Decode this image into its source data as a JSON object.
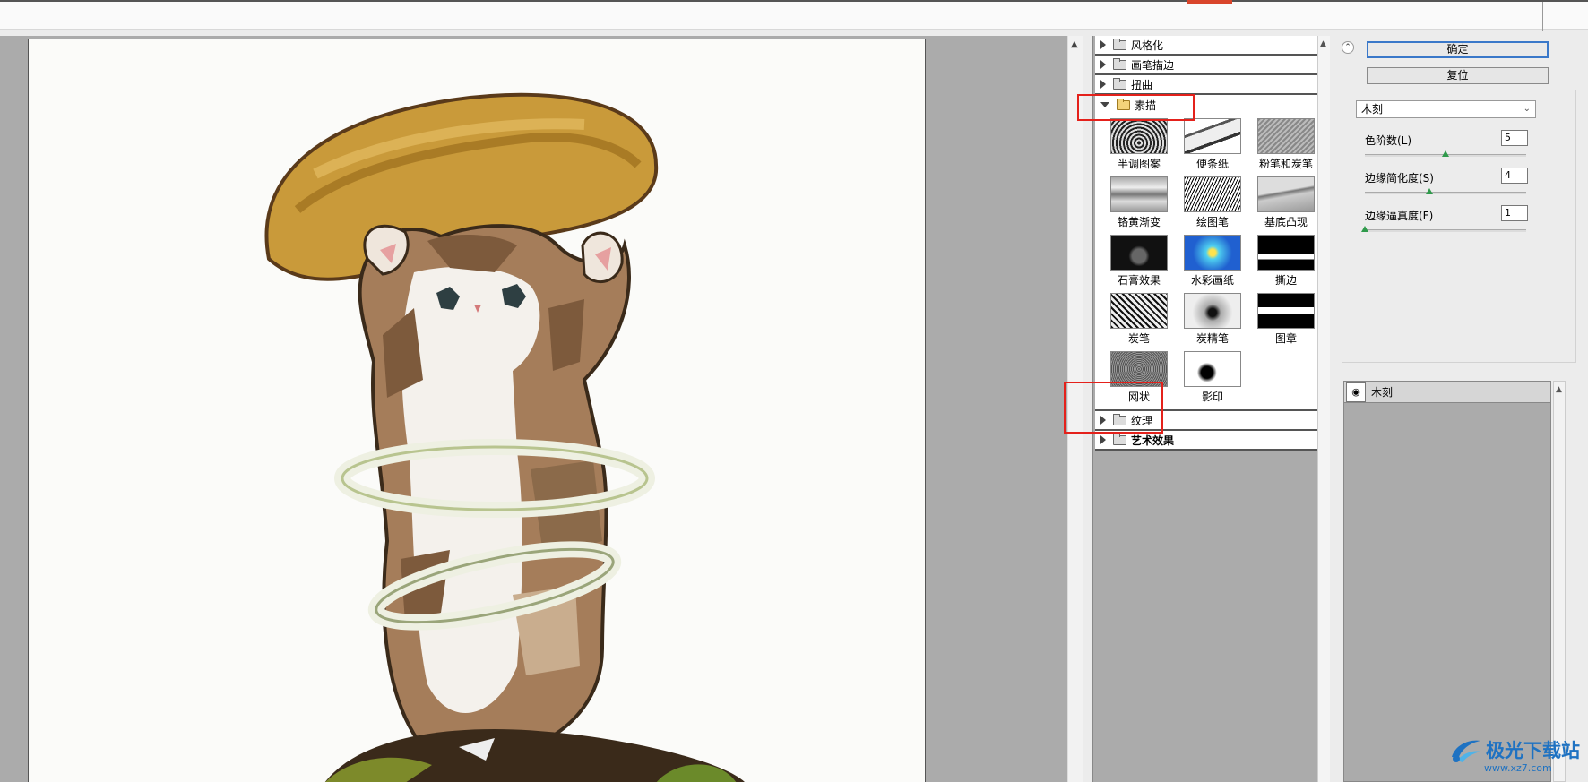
{
  "gallery": {
    "categories_top": [
      {
        "label": "风格化",
        "open": false
      },
      {
        "label": "画笔描边",
        "open": false
      },
      {
        "label": "扭曲",
        "open": false
      },
      {
        "label": "素描",
        "open": true
      }
    ],
    "sketch_filters": [
      {
        "label": "半调图案"
      },
      {
        "label": "便条纸"
      },
      {
        "label": "粉笔和炭笔"
      },
      {
        "label": "铬黄渐变"
      },
      {
        "label": "绘图笔"
      },
      {
        "label": "基底凸现"
      },
      {
        "label": "石膏效果"
      },
      {
        "label": "水彩画纸"
      },
      {
        "label": "撕边"
      },
      {
        "label": "炭笔"
      },
      {
        "label": "炭精笔"
      },
      {
        "label": "图章"
      },
      {
        "label": "网状"
      },
      {
        "label": "影印"
      }
    ],
    "categories_bottom": [
      {
        "label": "纹理",
        "open": false
      },
      {
        "label": "艺术效果",
        "open": false
      }
    ]
  },
  "settings": {
    "ok_label": "确定",
    "reset_label": "复位",
    "filter_select": "木刻",
    "params": [
      {
        "label": "色阶数(L)",
        "value": "5",
        "level": 0.5
      },
      {
        "label": "边缘简化度(S)",
        "value": "4",
        "level": 0.4
      },
      {
        "label": "边缘逼真度(F)",
        "value": "1",
        "level": 0.0
      }
    ],
    "layer_name": "木刻"
  },
  "watermark": {
    "text": "极光下载站",
    "url": "www.xz7.com"
  },
  "colors": {
    "highlight": "#e4211b",
    "accent_button": "#3a78c9",
    "slider_knob": "#2f9a4b",
    "watermark": "#1e72c2"
  }
}
